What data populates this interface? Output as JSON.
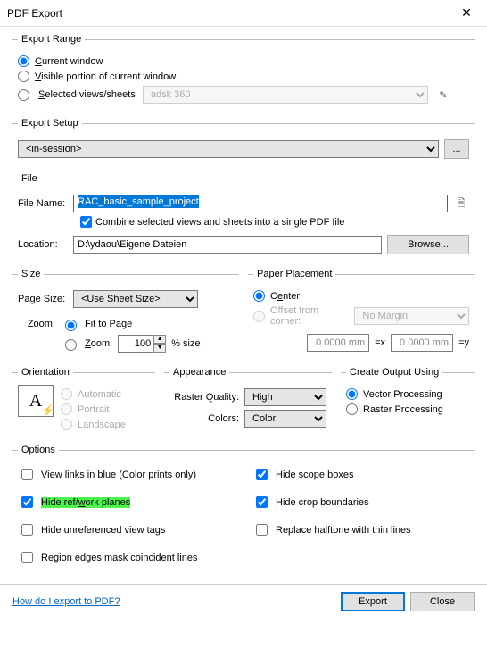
{
  "title": "PDF Export",
  "exportRange": {
    "legend": "Export Range",
    "current": "Current window",
    "visible": "Visible portion of current window",
    "selected": "Selected views/sheets",
    "selectedSet": "adsk 360",
    "selectedRadio": "current"
  },
  "exportSetup": {
    "legend": "Export Setup",
    "value": "<in-session>"
  },
  "file": {
    "legend": "File",
    "fileNameLabel": "File Name:",
    "fileName": "RAC_basic_sample_project",
    "combineLabel": "Combine selected views and sheets into a single PDF file",
    "combineChecked": true,
    "locationLabel": "Location:",
    "location": "D:\\ydaou\\Eigene Dateien",
    "browse": "Browse..."
  },
  "size": {
    "legend": "Size",
    "pageSizeLabel": "Page Size:",
    "pageSize": "<Use Sheet Size>",
    "zoomLabel": "Zoom:",
    "fitToPage": "Fit to Page",
    "zoom": "Zoom:",
    "zoomValue": "100",
    "zoomSuffix": "% size",
    "zoomMode": "fit"
  },
  "placement": {
    "legend": "Paper Placement",
    "center": "Center",
    "offset": "Offset from corner:",
    "margin": "No Margin",
    "x": "0.0000 mm",
    "y": "0.0000 mm",
    "eqx": "=x",
    "eqy": "=y",
    "mode": "center"
  },
  "orientation": {
    "legend": "Orientation",
    "auto": "Automatic",
    "portrait": "Portrait",
    "landscape": "Landscape"
  },
  "appearance": {
    "legend": "Appearance",
    "rasterLabel": "Raster Quality:",
    "raster": "High",
    "colorsLabel": "Colors:",
    "colors": "Color"
  },
  "output": {
    "legend": "Create Output Using",
    "vector": "Vector Processing",
    "raster": "Raster Processing",
    "mode": "vector"
  },
  "options": {
    "legend": "Options",
    "viewLinks": "View links in blue (Color prints only)",
    "hideScope": "Hide scope boxes",
    "hideRef": "Hide ref/work planes",
    "hideCrop": "Hide crop boundaries",
    "hideUnref": "Hide unreferenced view tags",
    "replaceHalf": "Replace halftone with thin lines",
    "regionEdges": "Region edges mask coincident lines",
    "checked": {
      "hideRef": true,
      "hideScope": true,
      "hideCrop": true
    }
  },
  "footer": {
    "help": "How do I export to PDF?",
    "export": "Export",
    "close": "Close"
  }
}
